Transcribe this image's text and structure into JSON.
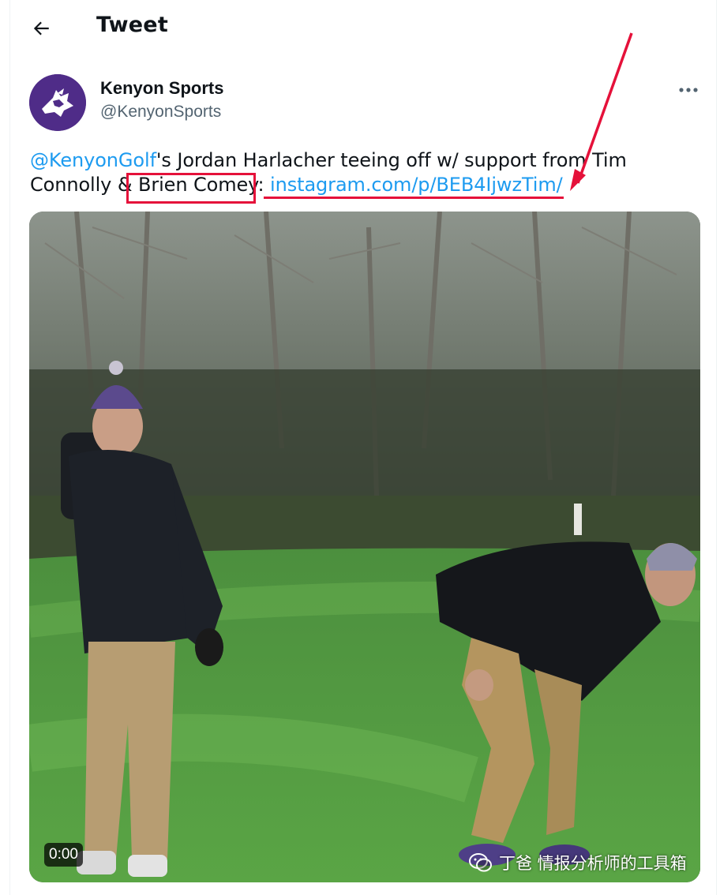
{
  "header": {
    "title": "Tweet",
    "back_icon": "arrow-left-icon"
  },
  "author": {
    "name": "Kenyon Sports",
    "handle": "@KenyonSports",
    "avatar_bg": "#4f2c88"
  },
  "tweet": {
    "mention": "@KenyonGolf",
    "text_a": "'s Jordan Harlacher teeing off w/ support from Tim Connolly & ",
    "highlighted_name": "Brien Comey",
    "text_b": ": ",
    "link": "instagram.com/p/BEB4IjwzTim/"
  },
  "media": {
    "timestamp": "0:00",
    "watermark": "丁爸 情报分析师的工具箱",
    "watermark_icon": "wechat-icon"
  },
  "colors": {
    "link": "#1d9bf0",
    "annotation": "#e5113a",
    "text": "#0f1419",
    "secondary": "#536471"
  }
}
